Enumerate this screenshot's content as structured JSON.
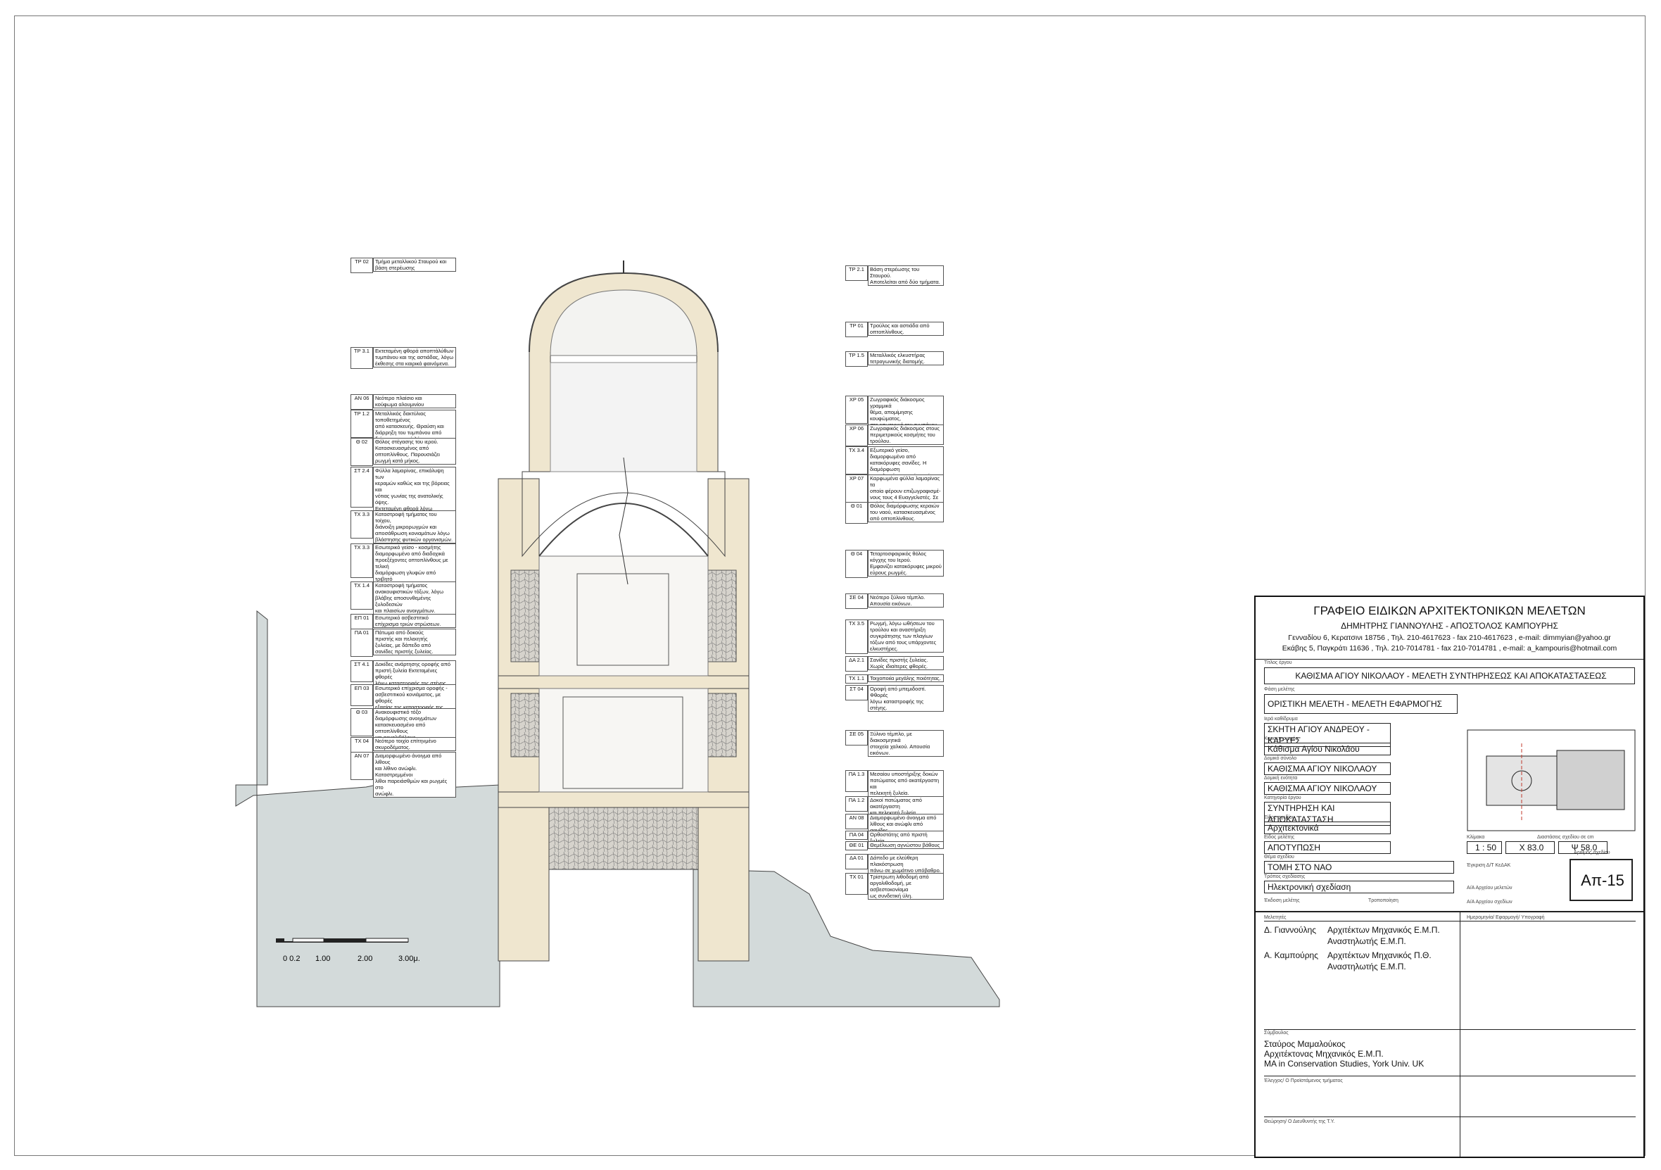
{
  "office": {
    "title": "ΓΡΑΦΕΙΟ ΕΙΔΙΚΩΝ ΑΡΧΙΤΕΚΤΟΝΙΚΩΝ ΜΕΛΕΤΩΝ",
    "names": "ΔΗΜΗΤΡΗΣ ΓΙΑΝΝΟΥΛΗΣ  -  ΑΠΟΣΤΟΛΟΣ ΚΑΜΠΟΥΡΗΣ",
    "address1": "Γενναδίου 6, Κερατσινι 18756 , Τηλ. 210-4617623 - fax 210-4617623 , e-mail: dimmyian@yahoo.gr",
    "address2": "Εκάβης 5, Παγκράτι 11636 , Τηλ. 210-7014781 - fax 210-7014781 , e-mail: a_kampouris@hotmail.com"
  },
  "titleblock": {
    "project_label": "Τίτλος έργου",
    "project": "ΚΑΘΙΣΜΑ ΑΓΙΟΥ ΝΙΚΟΛΑΟΥ - ΜΕΛΕΤΗ ΣΥΝΤΗΡΗΣΕΩΣ ΚΑΙ ΑΠΟΚΑΤΑΣΤΑΣΕΩΣ",
    "phase_label": "Φάση μελέτης",
    "phase": "ΟΡΙΣΤΙΚΗ ΜΕΛΕΤΗ - ΜΕΛΕΤΗ ΕΦΑΡΜΟΓΗΣ",
    "monastery_label": "Ιερά καθίδρυμα",
    "monastery": "ΣΚΗΤΗ ΑΓΙΟΥ ΑΝΔΡΕΟΥ - ΚΑΡΥΕΣ",
    "place_label": "Χαρακτηρισμός",
    "place": "Κάθισμα Αγίου Νικολάου",
    "complex_label": "Δομικό σύνολο",
    "complex": "ΚΑΘΙΣΜΑ ΑΓΙΟΥ ΝΙΚΟΛΑΟΥ",
    "building_label": "Δομική ενότητα",
    "building": "ΚΑΘΙΣΜΑ ΑΓΙΟΥ ΝΙΚΟΛΑΟΥ",
    "category_label": "Κατηγορία έργου",
    "category": "ΣΥΝΤΗΡΗΣΗ ΚΑΙ ΑΠΟΚΑΤΑΣΤΑΣΗ",
    "dtype_label": "Είδος σχεδίου",
    "dtype": "Αρχιτεκτονικά",
    "study_label": "Είδος μελέτης",
    "study": "ΑΠΟΤΥΠΩΣΗ",
    "scale_label": "Κλίμακα",
    "scale": "1 : 50",
    "dims_label": "Διαστάσεις σχεδίου σε cm",
    "dim_x": "Χ  83.0",
    "dim_y": "Ψ  58.0",
    "subject_label": "Θέμα σχεδίου",
    "subject": "ΤΟΜΗ ΣΤΟ ΝΑΟ",
    "tech_label": "Έγκριση Δ/Τ ΚεΔΑΚ",
    "method_label": "Τρόπος σχεδίασης",
    "method": "Ηλεκτρονική σχεδίαση",
    "aa1_label": "Α/Α Αρχείου μελετών",
    "aa2_label": "Α/Α Αρχείου σχεδίων",
    "num_label": "Αριθμός σχεδίου",
    "number": "Απ-15",
    "edit_label": "Έκδοση μελέτης",
    "rev_label": "Τροποποίηση",
    "designers_label": "Μελετητές",
    "sign_label": "Ημερομηνία/ Εφαρμογή/ Υπογραφή",
    "d1_name": "Δ. Γιαννούλης",
    "d1_role1": "Αρχιτέκτων Μηχανικός Ε.Μ.Π.",
    "d1_role2": "Αναστηλωτής Ε.Μ.Π.",
    "d2_name": "Α. Καμπούρης",
    "d2_role1": "Αρχιτέκτων Μηχανικός Π.Θ.",
    "d2_role2": "Αναστηλωτής Ε.Μ.Π.",
    "collab_label": "Σύμβουλος",
    "collab1": "Σταύρος  Μαμαλούκος",
    "collab2": "Αρχιτέκτονας Μηχανικός Ε.Μ.Π.",
    "collab3": "MA in Conservation Studies, York Univ. UK",
    "check_label": "Έλεγχος/ Ο Προϊστάμενος τμήματος",
    "approve_label": "Θεώρηση/ Ο Διευθυντής της Τ.Υ."
  },
  "scalebar": {
    "t0": "0 0.2",
    "t1": "1.00",
    "t2": "2.00",
    "t3": "3.00μ."
  },
  "notes_left": [
    {
      "code": "ΤΡ_02",
      "text": "Τμήμα μεταλλικού Σταυρού και\nβάση στερέωσης"
    },
    {
      "code": "ΤΡ_3.1",
      "text": "Εκτεταμένη φθορά αποπτάλύθων\nτυμπάνου και της αστιάδας, λόγω\nέκθεσης στα καιρικά φαινόμενα."
    },
    {
      "code": "ΑΝ_06",
      "text": "Νεότερο πλαίσιο και\nκούφωμα αλουμινίου"
    },
    {
      "code": "ΤΡ_1.2",
      "text": "Μεταλλικός δακτύλιος τοποθετημένος\nαπό κατασκευής. Θραύση και\nδιάρρηξη του τυμπάνου από\nδιόγκωση αυτού λόγω οξείδωσης."
    },
    {
      "code": "Θ_02",
      "text": "Θόλος στέγασης του ιερού.\nΚατασκευασμένος από\nοπτοπλίνθους. Παρουσιάζει\nρωγμή κατά μήκος."
    },
    {
      "code": "ΣΤ_2.4",
      "text": "Φύλλα λαμαρίνας, επικάλυψη των\nκεραμών καθώς και της βόρειας και\nνότιας γωνίας της ανατολικής όψης.\nΕκτεταμένη φθορά λόγω οξείδωσης\nμεταλλικών στοιχείων και καταστροφή\nλόγω υγρασίας."
    },
    {
      "code": "ΤΧ_3.3",
      "text": "Καταστροφή τμήματος του τοίχου,\nδιάνοιξη μικρορωγμών και\nαποσάθρωση κονιαμάτων λόγω\nβλάστησης φυτικών οργανισμών."
    },
    {
      "code": "ΤΧ_3.3",
      "text": "Εσωτερικό γείσο - κοσμήτης\nδιαμορφωμένο από διαδοχικά\nπροεξέχοντες οπτοπλίνθους με τελική\nδιαμόρφωση γλυφών από τριβητό\nασβεστοκονίαμα ."
    },
    {
      "code": "ΤΧ_1.4",
      "text": "Καταστροφή τμήματος\nανακουφιστικών τόξων, λόγω\nβλάβης αποσυνθεμένης ξυλοδεσιών\nκαι πλαισίων ανοιγμάτων."
    },
    {
      "code": "ΕΠ_01",
      "text": "Εσωτερικό ασβεστιτικό\nεπίχρισμα τριών στρώσεων."
    },
    {
      "code": "ΠΑ_01",
      "text": "Πάτωμα από δοκούς\nπριστής και πελεκητής\nξυλείας, με δάπεδο από\nσανίδες πριστής ξυλείας."
    },
    {
      "code": "ΣΤ_4.1",
      "text": "Δοκίδες ανάρτησης οροφής από\nπριστή ξυλεία Εκτεταμένες φθορές\nλόγω καταστροφής της στέγης."
    },
    {
      "code": "ΕΠ_03",
      "text": "Εσωτερικό επίχρισμα οροφής -\nασβεστιτικού κονιάματος, με φθορές\nεξαιτίας της καταστροφής της στέγης."
    },
    {
      "code": "Θ_03",
      "text": "Ανακουφιστικό τόξο\nδιαμόρφωσης ανοιγμάτων\nκατασκευασμένο από οπτοπλίνθους\nκαι αργολιθόλους."
    },
    {
      "code": "ΤΧ_04",
      "text": "Νεότερο τοιχίο επίτηνμένο\nσκυροδέματος."
    },
    {
      "code": "ΑΝ_07",
      "text": "Διαμορφωμένο άνοιγμα από λίθους\nκαι λίθινο ανώφλι. Καταστρεμμένοι\nλίθοι παρειάσθμών και ρωγμές στο\nανώφλι."
    }
  ],
  "notes_right": [
    {
      "code": "ΤΡ_2.1",
      "text": "Βάση στερέωσης του Σταυρού.\nΑποτελείται από δύο τμήματα."
    },
    {
      "code": "ΤΡ_01",
      "text": "Τρούλος και αστιάδα από\nοπτοπλίνθους."
    },
    {
      "code": "ΤΡ_1.5",
      "text": "Μεταλλικός ελκυστήρας\nτετραγωνικής διατομής."
    },
    {
      "code": "ΧΡ_05",
      "text": "Ζωγραφικός διάκοσμος γραμμικά\nθέμα, απομίμησης κουφώματος,\nστο εσωτερικό του τυμπάνου του\nτρούλου."
    },
    {
      "code": "ΧΡ_06",
      "text": "Ζωγραφικός διάκοσμος στους\nπεριμετρικούς κοσμήτες του\nτρούλου."
    },
    {
      "code": "ΤΧ_3.4",
      "text": "Εξωτερικό γείσο, διαμορφωμένο από\nκατακόρυφες σανίδες. Η διαμόρφωση\nτων γλυφών του γείσου είναι από\nτσιμέντο."
    },
    {
      "code": "ΧΡ_07",
      "text": "Καρφωμένα φύλλα λαμαρίνας τα\nοποία φέρουν επιζωγραφισμέ-\nνους τους 4 Ευαγγελιστές. Σε\nπολύ κακή κατάσταση."
    },
    {
      "code": "Θ_01",
      "text": "Θόλος διαμόρφωσης κεραιών\nτου ναού, κατασκευασμένος\nαπό οπτοπλίνθους."
    },
    {
      "code": "Θ_04",
      "text": "Τεταρτοσφαιρικός θόλος\nκόγχης του Ιερού.\nΕμφανίζει κατακόρυφες μικρού\nεύρους ρωγμές."
    },
    {
      "code": "ΣΕ_04",
      "text": "Νεότερο ξύλινο τέμπλο.\nΑπουσία εικόνων."
    },
    {
      "code": "ΤΧ_3.5",
      "text": "Ρωγμή, λόγω ωθήσεων του\nτρούλου και αναστήριξη\nσυγκράτησης των πλαγίων\nτόξων από τους υπάρχοντες\nελκυστήρες."
    },
    {
      "code": "ΔΑ_2.1",
      "text": "Σανίδες πριστής ξυλείας.\nΧωρίς ιδιαίτερες φθορές."
    },
    {
      "code": "ΤΧ_1.1",
      "text": "Τοιχοποιία μεγάλης ποιότητας."
    },
    {
      "code": "ΣΤ_04",
      "text": "Οροφή από μπεμιδοστί. Φθορές\nλόγω καταστροφής της στέγης."
    },
    {
      "code": "ΣΕ_05",
      "text": "Ξύλινο τέμπλο, με διακοσμητικά\nστοιχεία χαλκού. Απουσία εικόνων."
    },
    {
      "code": "ΠΑ_1.3",
      "text": "Μεσαίου υποστήριξης δοκών\nπατώματος από ακατέργαστη και\nπελεκητή ξυλεία."
    },
    {
      "code": "ΠΑ_1.2",
      "text": "Δοκοί πατώματος από ακατέργαστη\nκαι πελεκητή ξυλεία."
    },
    {
      "code": "ΑΝ_08",
      "text": "Διαμορφωμένο άνοιγμα από\nλίθους και ανώφλι από σανίδες"
    },
    {
      "code": "ΠΑ_04",
      "text": "Ορθοστάτης από πριστή ξυλεία"
    },
    {
      "code": "ΘΕ_01",
      "text": "Θεμέλιωση αγνώστου βάθους"
    },
    {
      "code": "ΔΑ_01",
      "text": "Δάπεδο με ελεύθερη πλακόστρωση\nπάνω σε χωμάτινο υπόβαθρο."
    },
    {
      "code": "ΤΧ_01",
      "text": "Τρίστρωτη λιθοδομή από\nαργολιθοδομή, με ασβεστοκονίαμα\nως συνδετική ύλη."
    }
  ]
}
